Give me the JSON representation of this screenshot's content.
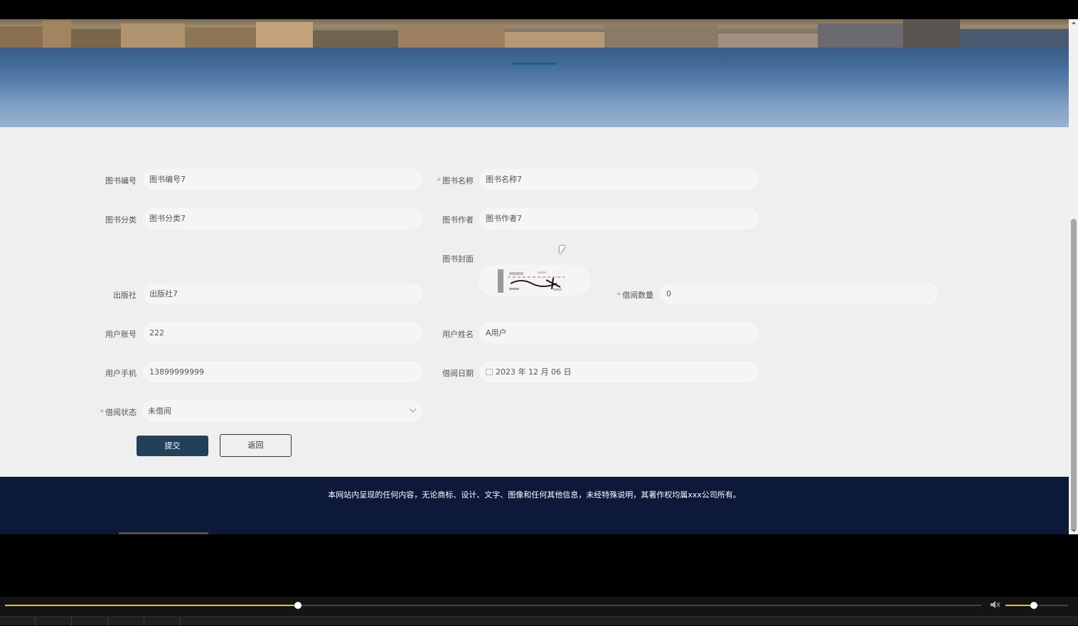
{
  "form": {
    "book_no": {
      "label": "图书编号",
      "value": "图书编号7"
    },
    "book_name": {
      "label": "图书名称",
      "value": "图书名称7",
      "required": "*"
    },
    "book_category": {
      "label": "图书分类",
      "value": "图书分类7"
    },
    "book_author": {
      "label": "图书作者",
      "value": "图书作者7"
    },
    "book_cover": {
      "label": "图书封面"
    },
    "publisher": {
      "label": "出版社",
      "value": "出版社7"
    },
    "borrow_qty": {
      "label": "借阅数量",
      "value": "0",
      "required": "*"
    },
    "user_account": {
      "label": "用户账号",
      "value": "222"
    },
    "user_name": {
      "label": "用户姓名",
      "value": "A用户"
    },
    "user_phone": {
      "label": "用户手机",
      "value": "13899999999"
    },
    "borrow_date": {
      "label": "借阅日期",
      "value": "2023 年 12 月 06 日"
    },
    "borrow_status": {
      "label": "借阅状态",
      "value": "未借阅",
      "required": "*"
    }
  },
  "buttons": {
    "submit": "提交",
    "back": "返回"
  },
  "footer": {
    "text": "本网站内呈现的任何内容，无论商标、设计、文字、图像和任何其他信息，未经特殊说明，其著作权均属xxx公司所有。"
  },
  "player": {
    "progress_fraction": 0.3,
    "volume_fraction": 0.45
  },
  "colors": {
    "primary_button": "#23405a",
    "footer_bg": "#0c1939",
    "accent": "#e6c31c",
    "required": "#e57373"
  }
}
